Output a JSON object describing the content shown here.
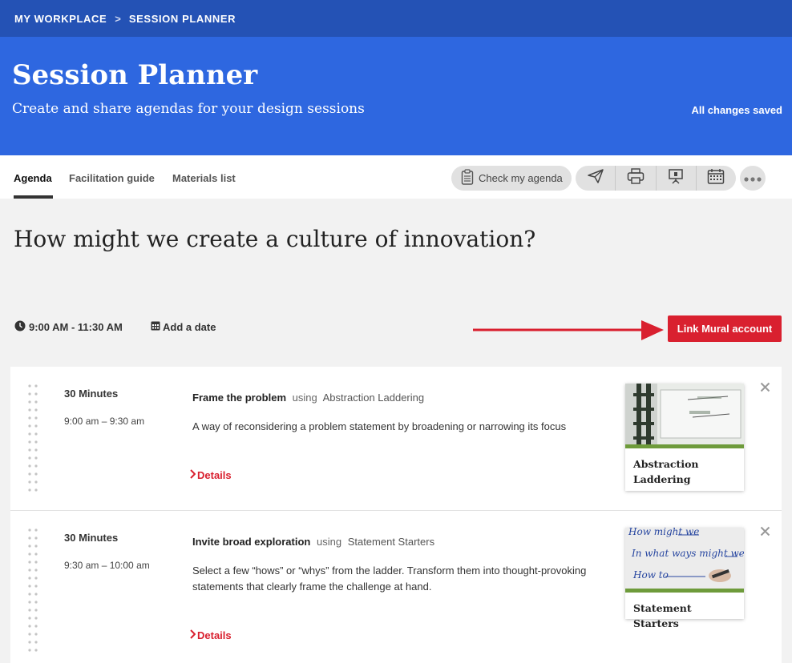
{
  "breadcrumb": {
    "root": "MY WORKPLACE",
    "separator": ">",
    "current": "SESSION PLANNER"
  },
  "hero": {
    "title": "Session Planner",
    "subtitle": "Create and share agendas for your design sessions",
    "save_status": "All changes saved"
  },
  "tabs": [
    {
      "label": "Agenda",
      "active": true
    },
    {
      "label": "Facilitation guide",
      "active": false
    },
    {
      "label": "Materials list",
      "active": false
    }
  ],
  "toolbar": {
    "check_agenda_label": "Check my agenda",
    "icons": [
      "send-icon",
      "print-icon",
      "presentation-icon",
      "calendar-icon"
    ],
    "more_icon": "more-icon"
  },
  "session": {
    "title": "How might we create a culture of innovation?",
    "time": "9:00 AM - 11:30 AM",
    "date_label": "Add a date",
    "link_mural_label": "Link Mural account"
  },
  "colors": {
    "header_dark": "#2452b5",
    "header": "#2e67e0",
    "accent_red": "#d9202f",
    "method_green": "#6e9b3b"
  },
  "agenda_items": [
    {
      "duration": "30 Minutes",
      "time_range": "9:00 am – 9:30 am",
      "activity": "Frame the problem",
      "using": "using",
      "method": "Abstraction Laddering",
      "description": "A way of reconsidering a problem statement by broadening or narrowing its focus",
      "details_label": "Details",
      "card_title": "Abstraction Laddering"
    },
    {
      "duration": "30 Minutes",
      "time_range": "9:30 am – 10:00 am",
      "activity": "Invite broad exploration",
      "using": "using",
      "method": "Statement Starters",
      "description": "Select a few “hows” or “whys” from the ladder. Transform them into thought-provoking statements that clearly frame the challenge at hand.",
      "details_label": "Details",
      "card_title": "Statement Starters",
      "thumb_lines": [
        "How might we",
        "In what ways might we",
        "How to"
      ]
    }
  ]
}
